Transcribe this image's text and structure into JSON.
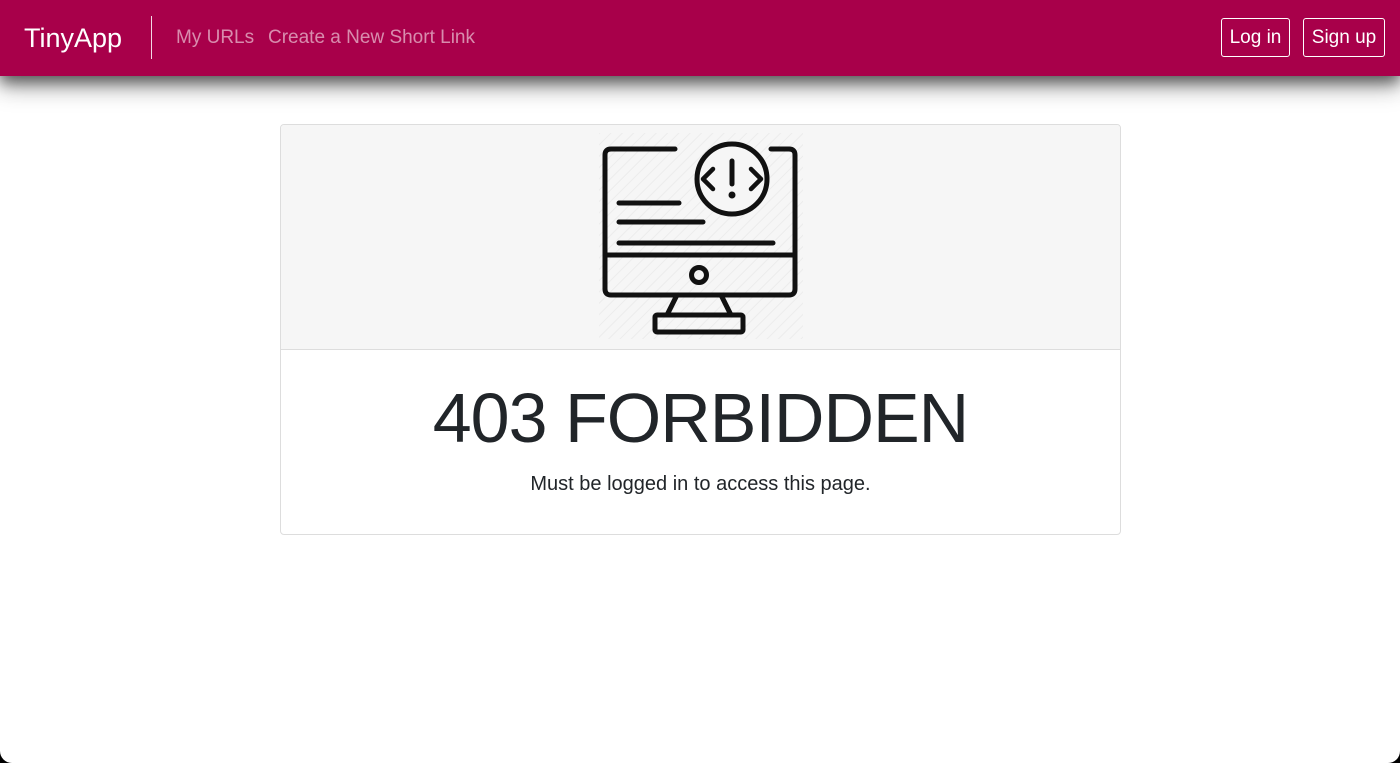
{
  "navbar": {
    "brand": "TinyApp",
    "links": [
      {
        "label": "My URLs"
      },
      {
        "label": "Create a New Short Link"
      }
    ],
    "login_label": "Log in",
    "signup_label": "Sign up"
  },
  "error_card": {
    "illustration_icon": "monitor-error-icon",
    "title": "403 FORBIDDEN",
    "message": "Must be logged in to access this page."
  },
  "colors": {
    "navbar_background": "#a8004a",
    "card_header_background": "#f6f6f6",
    "text": "#212529"
  }
}
